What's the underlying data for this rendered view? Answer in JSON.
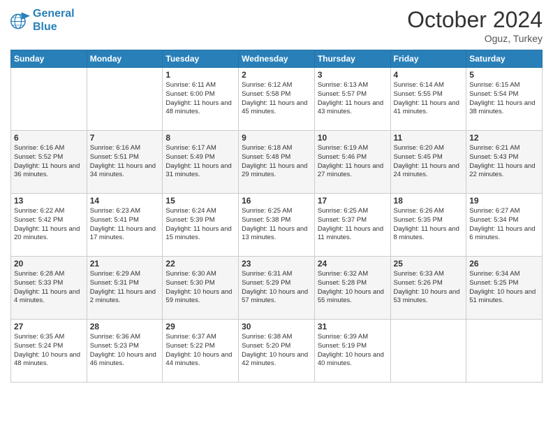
{
  "header": {
    "logo_line1": "General",
    "logo_line2": "Blue",
    "month": "October 2024",
    "location": "Oguz, Turkey"
  },
  "days_of_week": [
    "Sunday",
    "Monday",
    "Tuesday",
    "Wednesday",
    "Thursday",
    "Friday",
    "Saturday"
  ],
  "weeks": [
    [
      {
        "day": "",
        "info": ""
      },
      {
        "day": "",
        "info": ""
      },
      {
        "day": "1",
        "info": "Sunrise: 6:11 AM\nSunset: 6:00 PM\nDaylight: 11 hours and 48 minutes."
      },
      {
        "day": "2",
        "info": "Sunrise: 6:12 AM\nSunset: 5:58 PM\nDaylight: 11 hours and 45 minutes."
      },
      {
        "day": "3",
        "info": "Sunrise: 6:13 AM\nSunset: 5:57 PM\nDaylight: 11 hours and 43 minutes."
      },
      {
        "day": "4",
        "info": "Sunrise: 6:14 AM\nSunset: 5:55 PM\nDaylight: 11 hours and 41 minutes."
      },
      {
        "day": "5",
        "info": "Sunrise: 6:15 AM\nSunset: 5:54 PM\nDaylight: 11 hours and 38 minutes."
      }
    ],
    [
      {
        "day": "6",
        "info": "Sunrise: 6:16 AM\nSunset: 5:52 PM\nDaylight: 11 hours and 36 minutes."
      },
      {
        "day": "7",
        "info": "Sunrise: 6:16 AM\nSunset: 5:51 PM\nDaylight: 11 hours and 34 minutes."
      },
      {
        "day": "8",
        "info": "Sunrise: 6:17 AM\nSunset: 5:49 PM\nDaylight: 11 hours and 31 minutes."
      },
      {
        "day": "9",
        "info": "Sunrise: 6:18 AM\nSunset: 5:48 PM\nDaylight: 11 hours and 29 minutes."
      },
      {
        "day": "10",
        "info": "Sunrise: 6:19 AM\nSunset: 5:46 PM\nDaylight: 11 hours and 27 minutes."
      },
      {
        "day": "11",
        "info": "Sunrise: 6:20 AM\nSunset: 5:45 PM\nDaylight: 11 hours and 24 minutes."
      },
      {
        "day": "12",
        "info": "Sunrise: 6:21 AM\nSunset: 5:43 PM\nDaylight: 11 hours and 22 minutes."
      }
    ],
    [
      {
        "day": "13",
        "info": "Sunrise: 6:22 AM\nSunset: 5:42 PM\nDaylight: 11 hours and 20 minutes."
      },
      {
        "day": "14",
        "info": "Sunrise: 6:23 AM\nSunset: 5:41 PM\nDaylight: 11 hours and 17 minutes."
      },
      {
        "day": "15",
        "info": "Sunrise: 6:24 AM\nSunset: 5:39 PM\nDaylight: 11 hours and 15 minutes."
      },
      {
        "day": "16",
        "info": "Sunrise: 6:25 AM\nSunset: 5:38 PM\nDaylight: 11 hours and 13 minutes."
      },
      {
        "day": "17",
        "info": "Sunrise: 6:25 AM\nSunset: 5:37 PM\nDaylight: 11 hours and 11 minutes."
      },
      {
        "day": "18",
        "info": "Sunrise: 6:26 AM\nSunset: 5:35 PM\nDaylight: 11 hours and 8 minutes."
      },
      {
        "day": "19",
        "info": "Sunrise: 6:27 AM\nSunset: 5:34 PM\nDaylight: 11 hours and 6 minutes."
      }
    ],
    [
      {
        "day": "20",
        "info": "Sunrise: 6:28 AM\nSunset: 5:33 PM\nDaylight: 11 hours and 4 minutes."
      },
      {
        "day": "21",
        "info": "Sunrise: 6:29 AM\nSunset: 5:31 PM\nDaylight: 11 hours and 2 minutes."
      },
      {
        "day": "22",
        "info": "Sunrise: 6:30 AM\nSunset: 5:30 PM\nDaylight: 10 hours and 59 minutes."
      },
      {
        "day": "23",
        "info": "Sunrise: 6:31 AM\nSunset: 5:29 PM\nDaylight: 10 hours and 57 minutes."
      },
      {
        "day": "24",
        "info": "Sunrise: 6:32 AM\nSunset: 5:28 PM\nDaylight: 10 hours and 55 minutes."
      },
      {
        "day": "25",
        "info": "Sunrise: 6:33 AM\nSunset: 5:26 PM\nDaylight: 10 hours and 53 minutes."
      },
      {
        "day": "26",
        "info": "Sunrise: 6:34 AM\nSunset: 5:25 PM\nDaylight: 10 hours and 51 minutes."
      }
    ],
    [
      {
        "day": "27",
        "info": "Sunrise: 6:35 AM\nSunset: 5:24 PM\nDaylight: 10 hours and 48 minutes."
      },
      {
        "day": "28",
        "info": "Sunrise: 6:36 AM\nSunset: 5:23 PM\nDaylight: 10 hours and 46 minutes."
      },
      {
        "day": "29",
        "info": "Sunrise: 6:37 AM\nSunset: 5:22 PM\nDaylight: 10 hours and 44 minutes."
      },
      {
        "day": "30",
        "info": "Sunrise: 6:38 AM\nSunset: 5:20 PM\nDaylight: 10 hours and 42 minutes."
      },
      {
        "day": "31",
        "info": "Sunrise: 6:39 AM\nSunset: 5:19 PM\nDaylight: 10 hours and 40 minutes."
      },
      {
        "day": "",
        "info": ""
      },
      {
        "day": "",
        "info": ""
      }
    ]
  ]
}
